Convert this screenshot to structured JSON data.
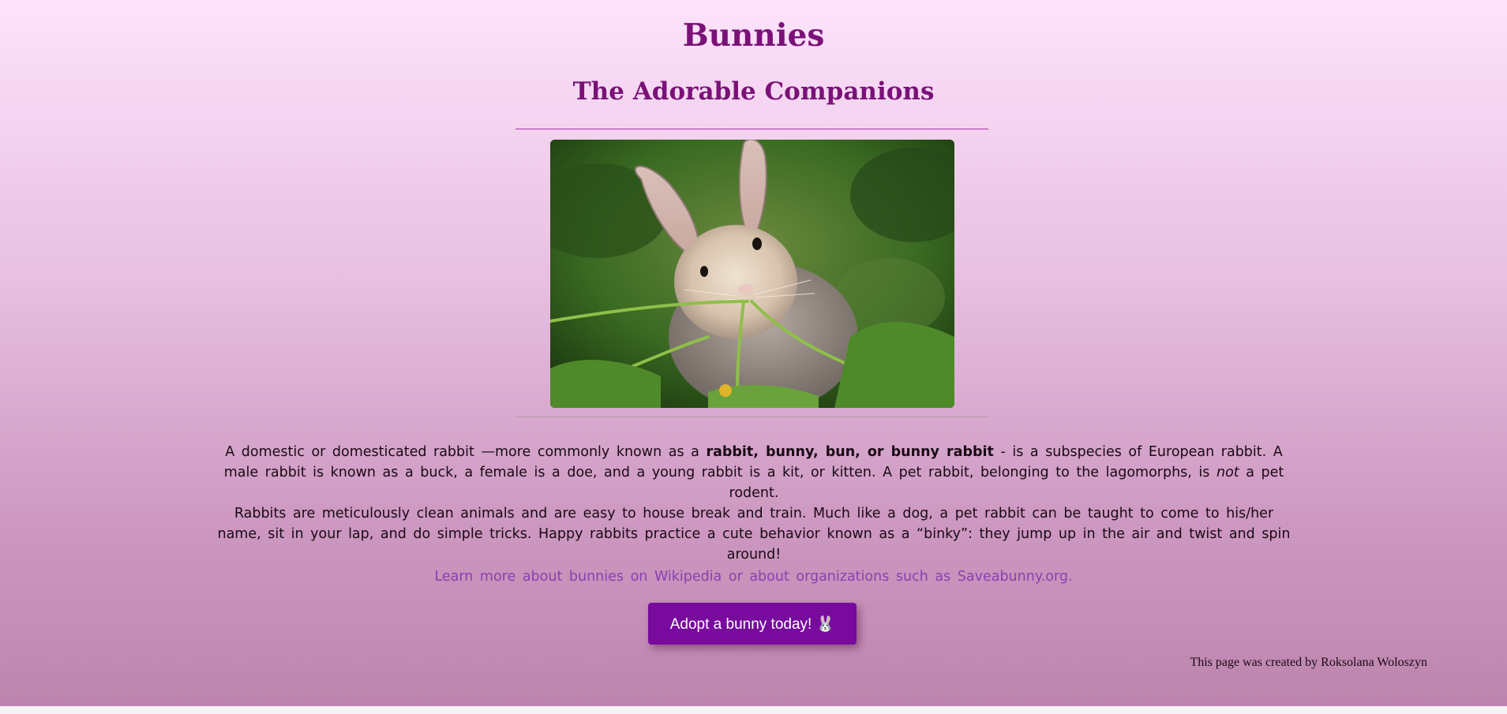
{
  "header": {
    "title": "Bunnies",
    "subtitle": "The Adorable Companions"
  },
  "image": {
    "alt": "A bunny eating grass"
  },
  "intro": {
    "text_before": "A domestic or domesticated rabbit —more commonly known as a ",
    "bold_names": "rabbit, bunny, bun, or bunny rabbit",
    "text_middle": " - is a subspecies of European rabbit. A male rabbit is known as a buck, a female is a doe, and a young rabbit is a kit, or kitten. A pet rabbit, belonging to the lagomorphs, is ",
    "italic_word": "not",
    "text_after": " a pet rodent."
  },
  "care": {
    "text": "Rabbits are meticulously clean animals and are easy to house break and train. Much like a dog, a pet rabbit can be taught to come to his/her name, sit in your lap, and do simple tricks. Happy rabbits practice a cute behavior known as a “binky”: they jump up in the air and twist and spin around!"
  },
  "learn_more": {
    "prefix": "Learn more about bunnies on ",
    "wikipedia_link": "Wikipedia",
    "middle": " or about organizations such as ",
    "saveabunny_link": "Saveabunny.org",
    "suffix": "."
  },
  "cta": {
    "label": "Adopt a bunny today! 🐰"
  },
  "footer": {
    "credit": "This page was created by Roksolana Woloszyn"
  }
}
